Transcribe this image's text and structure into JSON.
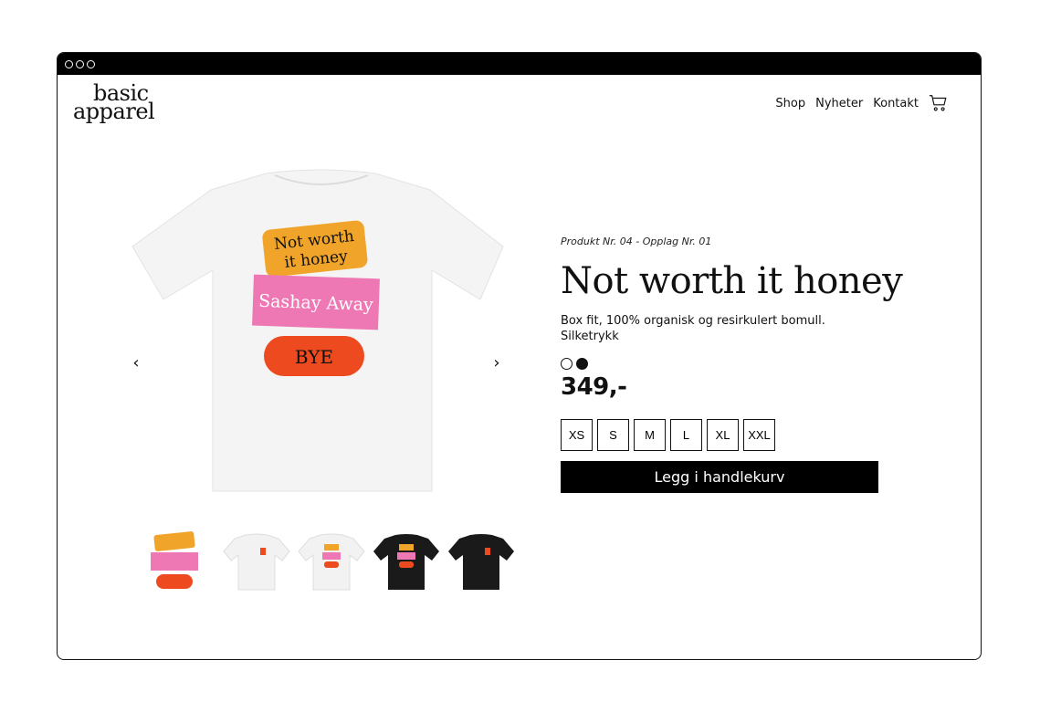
{
  "brand": {
    "line1": "basic",
    "line2": "apparel"
  },
  "nav": {
    "items": [
      "Shop",
      "Nyheter",
      "Kontakt"
    ],
    "cart_icon": "cart-icon"
  },
  "product": {
    "meta": "Produkt Nr. 04 - Opplag Nr. 01",
    "title": "Not worth it honey",
    "description_line1": "Box fit, 100% organisk og resirkulert bomull.",
    "description_line2": "Silketrykk",
    "colors": [
      "white",
      "black"
    ],
    "price": "349,-",
    "sizes": [
      "XS",
      "S",
      "M",
      "L",
      "XL",
      "XXL"
    ],
    "add_to_cart": "Legg i handlekurv"
  },
  "print": {
    "sticker1_line1": "Not worth",
    "sticker1_line2": "it honey",
    "sticker2": "Sashay Away",
    "sticker3": "BYE"
  },
  "gallery": {
    "prev_icon": "‹",
    "next_icon": "›",
    "thumbnails": [
      "print-artwork",
      "white-front",
      "white-back",
      "black-back",
      "black-front"
    ]
  },
  "colors_hex": {
    "orange_sticker": "#F0A52A",
    "pink_sticker": "#EE78B4",
    "red_sticker": "#EE4A1F",
    "black": "#000000"
  }
}
